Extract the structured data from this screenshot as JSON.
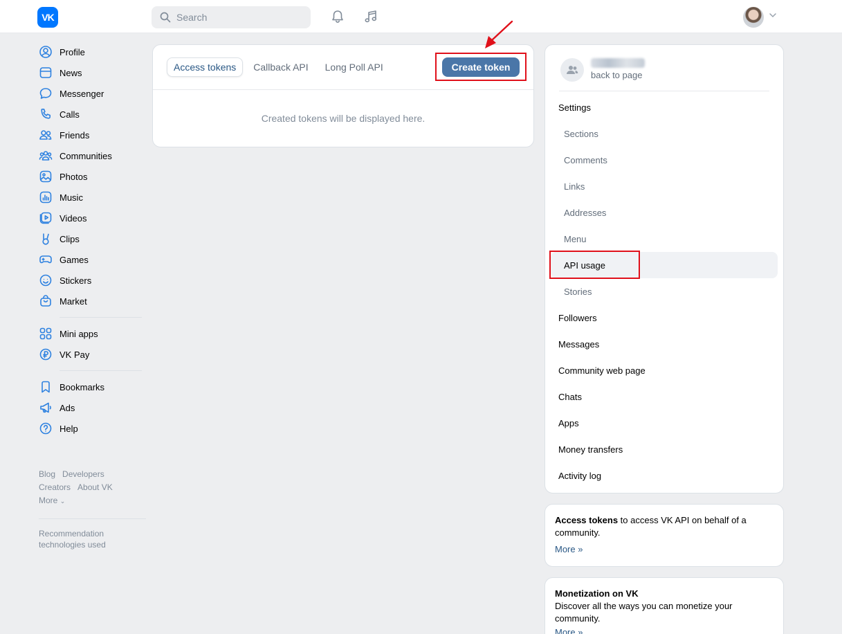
{
  "header": {
    "logo_text": "VK",
    "search_placeholder": "Search"
  },
  "leftnav": {
    "group1": [
      {
        "label": "Profile",
        "icon": "user-circle-icon"
      },
      {
        "label": "News",
        "icon": "news-icon"
      },
      {
        "label": "Messenger",
        "icon": "chat-bubble-icon"
      },
      {
        "label": "Calls",
        "icon": "phone-icon"
      },
      {
        "label": "Friends",
        "icon": "users-icon"
      },
      {
        "label": "Communities",
        "icon": "communities-icon"
      },
      {
        "label": "Photos",
        "icon": "image-icon"
      },
      {
        "label": "Music",
        "icon": "music-icon"
      },
      {
        "label": "Videos",
        "icon": "video-icon"
      },
      {
        "label": "Clips",
        "icon": "clips-icon"
      },
      {
        "label": "Games",
        "icon": "gamepad-icon"
      },
      {
        "label": "Stickers",
        "icon": "smile-icon"
      },
      {
        "label": "Market",
        "icon": "bag-icon"
      }
    ],
    "group2": [
      {
        "label": "Mini apps",
        "icon": "grid-icon"
      },
      {
        "label": "VK Pay",
        "icon": "ruble-icon"
      }
    ],
    "group3": [
      {
        "label": "Bookmarks",
        "icon": "bookmark-icon"
      },
      {
        "label": "Ads",
        "icon": "megaphone-icon"
      },
      {
        "label": "Help",
        "icon": "help-icon"
      }
    ],
    "footer": {
      "blog": "Blog",
      "developers": "Developers",
      "creators": "Creators",
      "about": "About VK",
      "more": "More",
      "recommendation": "Recommendation technologies used"
    }
  },
  "main": {
    "tabs": [
      {
        "label": "Access tokens",
        "active": true
      },
      {
        "label": "Callback API",
        "active": false
      },
      {
        "label": "Long Poll API",
        "active": false
      }
    ],
    "create_button": "Create token",
    "empty_message": "Created tokens will be displayed here."
  },
  "rightpanel": {
    "back_link": "back to page",
    "menu": [
      {
        "label": "Settings",
        "type": "top"
      },
      {
        "label": "Sections",
        "type": "sub"
      },
      {
        "label": "Comments",
        "type": "sub"
      },
      {
        "label": "Links",
        "type": "sub"
      },
      {
        "label": "Addresses",
        "type": "sub"
      },
      {
        "label": "Menu",
        "type": "sub"
      },
      {
        "label": "API usage",
        "type": "active"
      },
      {
        "label": "Stories",
        "type": "sub"
      },
      {
        "label": "Followers",
        "type": "top"
      },
      {
        "label": "Messages",
        "type": "top"
      },
      {
        "label": "Community web page",
        "type": "top"
      },
      {
        "label": "Chats",
        "type": "top"
      },
      {
        "label": "Apps",
        "type": "top"
      },
      {
        "label": "Money transfers",
        "type": "top"
      },
      {
        "label": "Activity log",
        "type": "top"
      }
    ]
  },
  "info_cards": {
    "access": {
      "bold": "Access tokens",
      "text": " to access VK API on behalf of a community.",
      "more": "More »"
    },
    "monetization": {
      "bold": "Monetization on VK",
      "text": "Discover all the ways you can monetize your community.",
      "more": "More »"
    }
  },
  "colors": {
    "brand": "#0077ff",
    "button": "#4a76a8",
    "highlight": "#e0101a",
    "link": "#2a5885"
  }
}
